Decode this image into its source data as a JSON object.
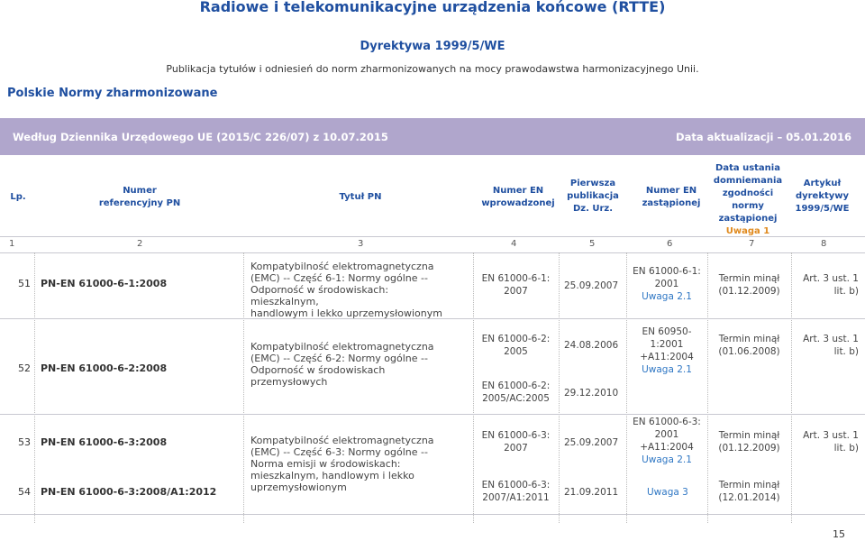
{
  "header": {
    "title": "Radiowe i telekomunikacyjne urządzenia końcowe (RTTE)",
    "directive": "Dyrektywa 1999/5/WE",
    "publication": "Publikacja tytułów i odniesień do norm zharmonizowanych na mocy prawodawstwa harmonizacyjnego Unii.",
    "pn_title": "Polskie Normy zharmonizowane"
  },
  "banner": {
    "left": "Według Dziennika Urzędowego UE (2015/C 226/07) z 10.07.2015",
    "right": "Data aktualizacji – 05.01.2016"
  },
  "colors": {
    "accent": "#1f4fa0",
    "banner": "#b0a6cc",
    "note": "#e08a1e",
    "warn": "#2f77c4"
  },
  "columns": [
    {
      "l1": "Lp.",
      "l2": "",
      "l3": "",
      "l4": "",
      "l5": "",
      "note": ""
    },
    {
      "l1": "Numer",
      "l2": "referencyjny PN",
      "l3": "",
      "l4": "",
      "l5": "",
      "note": ""
    },
    {
      "l1": "Tytuł PN",
      "l2": "",
      "l3": "",
      "l4": "",
      "l5": "",
      "note": ""
    },
    {
      "l1": "Numer EN",
      "l2": "wprowadzonej",
      "l3": "",
      "l4": "",
      "l5": "",
      "note": ""
    },
    {
      "l1": "Pierwsza",
      "l2": "publikacja",
      "l3": "Dz. Urz.",
      "l4": "",
      "l5": "",
      "note": ""
    },
    {
      "l1": "Numer EN",
      "l2": "zastąpionej",
      "l3": "",
      "l4": "",
      "l5": "",
      "note": ""
    },
    {
      "l1": "Data ustania",
      "l2": "domniemania",
      "l3": "zgodności",
      "l4": "normy",
      "l5": "zastąpionej",
      "note": "Uwaga 1"
    },
    {
      "l1": "Artykuł",
      "l2": "dyrektywy",
      "l3": "1999/5/WE",
      "l4": "",
      "l5": "",
      "note": ""
    }
  ],
  "col_numbers": [
    "1",
    "2",
    "3",
    "4",
    "5",
    "6",
    "7",
    "8"
  ],
  "rows": {
    "r51": {
      "lp": "51",
      "code": "PN-EN 61000-6-1:2008",
      "title": [
        "Kompatybilność elektromagnetyczna",
        "(EMC) -- Część 6-1: Normy ogólne --",
        "Odporność w środowiskach: mieszkalnym,",
        "handlowym i lekko uprzemysłowionym"
      ],
      "en": [
        "EN 61000-6-1:",
        "2007"
      ],
      "pub": "25.09.2007",
      "replaced": [
        "EN 61000-6-1:",
        "2001"
      ],
      "replaced_note": "Uwaga 2.1",
      "term": [
        "Termin minął",
        "(01.12.2009)"
      ],
      "art": [
        "Art. 3 ust. 1",
        "lit. b)"
      ]
    },
    "r52": {
      "lp": "52",
      "code": "PN-EN 61000-6-2:2008",
      "title": [
        "Kompatybilność elektromagnetyczna",
        "(EMC) -- Część 6-2: Normy ogólne --",
        "Odporność w środowiskach",
        "przemysłowych"
      ],
      "en_a": [
        "EN 61000-6-2:",
        "2005"
      ],
      "en_b": [
        "EN 61000-6-2:",
        "2005/AC:2005"
      ],
      "pub_a": "24.08.2006",
      "pub_b": "29.12.2010",
      "replaced": [
        "EN 60950-1:2001",
        "+A11:2004"
      ],
      "replaced_note": "Uwaga 2.1",
      "term": [
        "Termin minął",
        "(01.06.2008)"
      ],
      "art": [
        "Art. 3 ust. 1",
        "lit. b)"
      ]
    },
    "r53": {
      "lp": "53",
      "code": "PN-EN 61000-6-3:2008",
      "title": [
        "Kompatybilność elektromagnetyczna",
        "(EMC) -- Część 6-3: Normy ogólne --",
        "Norma emisji w środowiskach:",
        "mieszkalnym, handlowym i lekko",
        "uprzemysłowionym"
      ],
      "en": [
        "EN 61000-6-3:",
        "2007"
      ],
      "pub": "25.09.2007",
      "replaced": [
        "EN 61000-6-3:",
        "2001",
        "+A11:2004"
      ],
      "replaced_note": "Uwaga 2.1",
      "term": [
        "Termin minął",
        "(01.12.2009)"
      ],
      "art": [
        "Art. 3 ust. 1",
        "lit. b)"
      ]
    },
    "r54": {
      "lp": "54",
      "code": "PN-EN 61000-6-3:2008/A1:2012",
      "en": [
        "EN 61000-6-3:",
        "2007/A1:2011"
      ],
      "pub": "21.09.2011",
      "replaced_note": "Uwaga 3",
      "term": [
        "Termin minął",
        "(12.01.2014)"
      ]
    }
  },
  "footer": {
    "page": "15"
  }
}
